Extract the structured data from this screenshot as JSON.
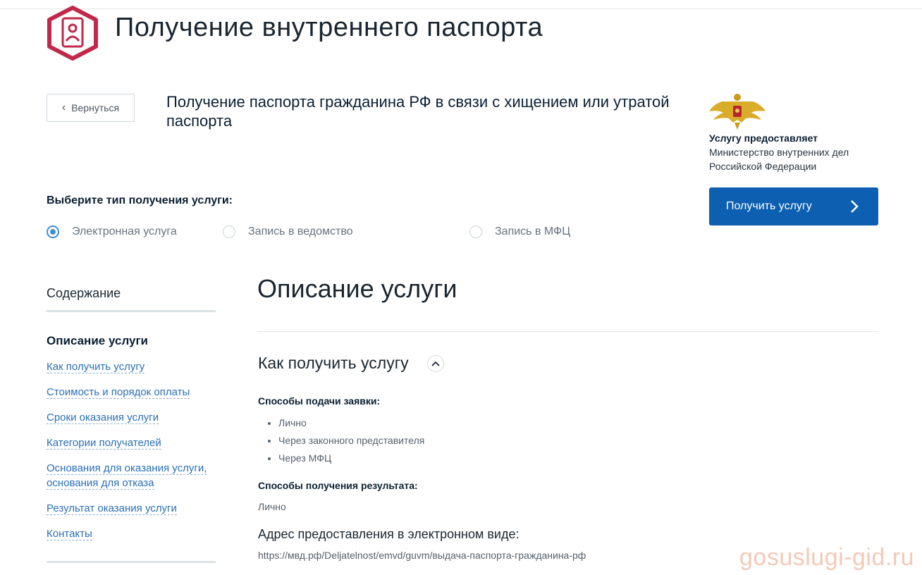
{
  "header": {
    "title": "Получение внутреннего паспорта",
    "icon": "passport-icon",
    "icon_color": "#c1284a"
  },
  "back_button": {
    "label": "Вернуться"
  },
  "service": {
    "title": "Получение паспорта гражданина РФ в связи с хищением или утратой паспорта"
  },
  "provider": {
    "caption": "Услугу предоставляет",
    "name": "Министерство внутренних дел Российской Федерации",
    "icon": "emblem-icon"
  },
  "get_service_button": {
    "label": "Получить услугу",
    "color": "#0d5fb1"
  },
  "service_type": {
    "label": "Выберите тип получения услуги:",
    "options": [
      {
        "label": "Электронная услуга",
        "selected": true
      },
      {
        "label": "Запись в ведомство",
        "selected": false
      },
      {
        "label": "Запись в МФЦ",
        "selected": false
      }
    ]
  },
  "toc": {
    "title": "Содержание",
    "current": "Описание услуги",
    "links": [
      "Как получить услугу",
      "Стоимость и порядок оплаты",
      "Сроки оказания услуги",
      "Категории получателей",
      "Основания для оказания услуги,",
      "основания для отказа",
      "Результат оказания услуги",
      "Контакты"
    ],
    "link_color": "#2a6fba"
  },
  "content": {
    "section_title": "Описание услуги",
    "subsection_title": "Как получить услугу",
    "submission_label": "Способы подачи заявки:",
    "submission_methods": [
      "Лично",
      "Через законного представителя",
      "Через МФЦ"
    ],
    "result_label": "Способы получения результата:",
    "result_value": "Лично",
    "address_label": "Адрес предоставления в электронном виде:",
    "address_value": "https://мвд.рф/Deljatelnost/emvd/guvm/выдача-паспорта-гражданина-рф"
  },
  "watermark": "gosuslugi-gid.ru"
}
